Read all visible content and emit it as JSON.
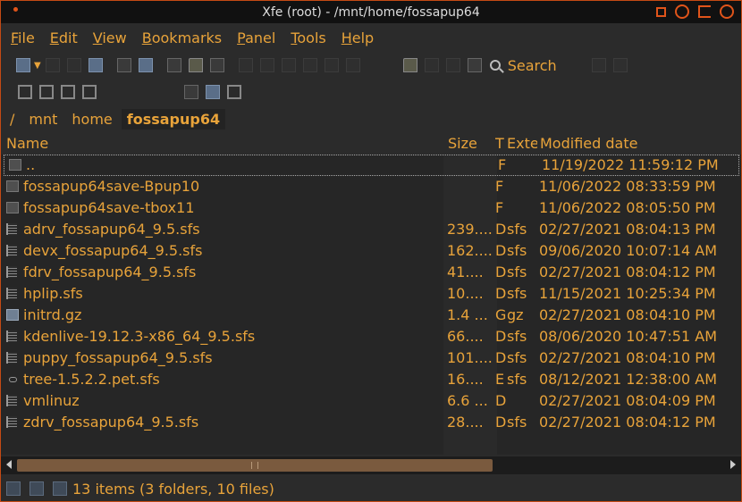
{
  "window": {
    "title": "Xfe (root) - /mnt/home/fossapup64"
  },
  "menu": [
    {
      "label": "File",
      "key": "F",
      "rest": "ile"
    },
    {
      "label": "Edit",
      "key": "E",
      "rest": "dit"
    },
    {
      "label": "View",
      "key": "V",
      "rest": "iew"
    },
    {
      "label": "Bookmarks",
      "key": "B",
      "rest": "ookmarks"
    },
    {
      "label": "Panel",
      "key": "P",
      "rest": "anel"
    },
    {
      "label": "Tools",
      "key": "T",
      "rest": "ools"
    },
    {
      "label": "Help",
      "key": "H",
      "rest": "elp"
    }
  ],
  "toolbar": {
    "search_label": "Search"
  },
  "path": {
    "root": "/",
    "segments": [
      "mnt",
      "home",
      "fossapup64"
    ]
  },
  "columns": {
    "name": "Name",
    "size": "Size",
    "type": "T",
    "ext": "Exte",
    "date": "Modified date"
  },
  "files": [
    {
      "name": "..",
      "size": "",
      "type": "F",
      "ext": "",
      "date": "11/19/2022 11:59:12 PM",
      "icon": "folder"
    },
    {
      "name": "fossapup64save-Bpup10",
      "size": "",
      "type": "F",
      "ext": "",
      "date": "11/06/2022 08:33:59 PM",
      "icon": "folder"
    },
    {
      "name": "fossapup64save-tbox11",
      "size": "",
      "type": "F",
      "ext": "",
      "date": "11/06/2022 08:05:50 PM",
      "icon": "folder"
    },
    {
      "name": "adrv_fossapup64_9.5.sfs",
      "size": "239....",
      "type": "D",
      "ext": "sfs",
      "date": "02/27/2021 08:04:13 PM",
      "icon": "file"
    },
    {
      "name": "devx_fossapup64_9.5.sfs",
      "size": "162....",
      "type": "D",
      "ext": "sfs",
      "date": "09/06/2020 10:07:14 AM",
      "icon": "file"
    },
    {
      "name": "fdrv_fossapup64_9.5.sfs",
      "size": "41....",
      "type": "D",
      "ext": "sfs",
      "date": "02/27/2021 08:04:12 PM",
      "icon": "file"
    },
    {
      "name": "hplip.sfs",
      "size": "10....",
      "type": "D",
      "ext": "sfs",
      "date": "11/15/2021 10:25:34 PM",
      "icon": "file"
    },
    {
      "name": "initrd.gz",
      "size": "1.4 ...",
      "type": "G",
      "ext": "gz",
      "date": "02/27/2021 08:04:10 PM",
      "icon": "pkg"
    },
    {
      "name": "kdenlive-19.12.3-x86_64_9.5.sfs",
      "size": "66....",
      "type": "D",
      "ext": "sfs",
      "date": "08/06/2020 10:47:51 AM",
      "icon": "file"
    },
    {
      "name": "puppy_fossapup64_9.5.sfs",
      "size": "101....",
      "type": "D",
      "ext": "sfs",
      "date": "02/27/2021 08:04:10 PM",
      "icon": "file"
    },
    {
      "name": "tree-1.5.2.2.pet.sfs",
      "size": "16....",
      "type": "E",
      "ext": "sfs",
      "date": "08/12/2021 12:38:00 AM",
      "icon": "link"
    },
    {
      "name": "vmlinuz",
      "size": "6.6 ...",
      "type": "D",
      "ext": "",
      "date": "02/27/2021 08:04:09 PM",
      "icon": "file"
    },
    {
      "name": "zdrv_fossapup64_9.5.sfs",
      "size": "28....",
      "type": "D",
      "ext": "sfs",
      "date": "02/27/2021 08:04:12 PM",
      "icon": "file"
    }
  ],
  "status": {
    "text": "13 items (3 folders, 10 files)"
  }
}
